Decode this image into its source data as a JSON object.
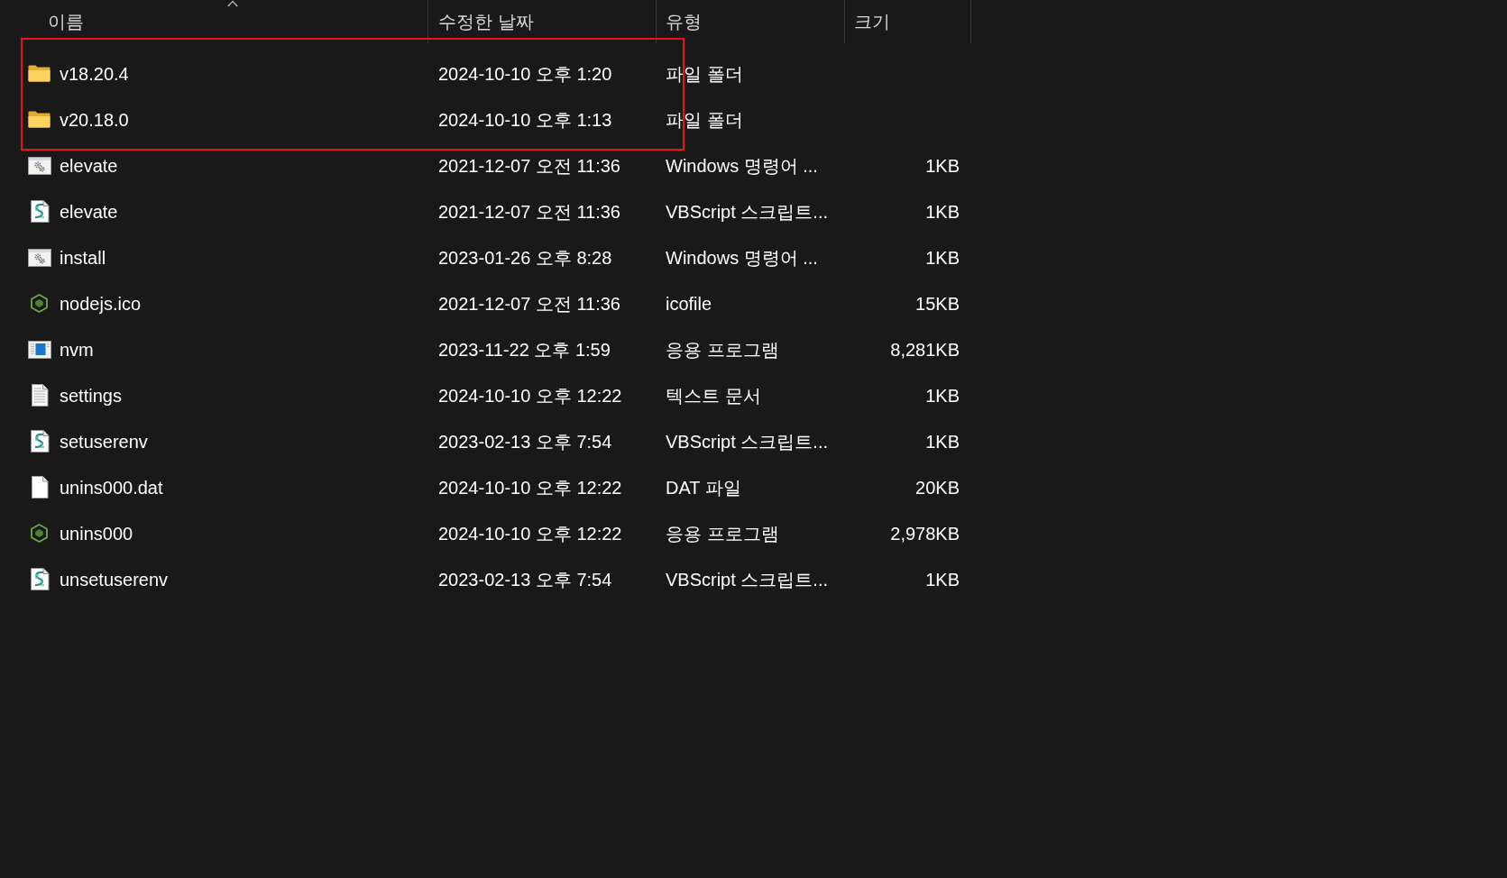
{
  "table": {
    "columns": [
      {
        "label": "이름",
        "sorted": true
      },
      {
        "label": "수정한 날짜",
        "sorted": false
      },
      {
        "label": "유형",
        "sorted": false
      },
      {
        "label": "크기",
        "sorted": false
      }
    ],
    "rows": [
      {
        "kind": "folder",
        "name": "v18.20.4",
        "modified": "2024-10-10 오후 1:20",
        "type": "파일 폴더",
        "marked": true
      },
      {
        "kind": "folder",
        "name": "v20.18.0",
        "modified": "2024-10-10 오후 1:13",
        "type": "파일 폴더",
        "marked": true
      },
      {
        "kind": "batch",
        "name": "elevate",
        "modified": "2021-12-07 오전 11:36",
        "type": "Windows 명령어 ...",
        "size": "1KB",
        "marked": false
      },
      {
        "kind": "script",
        "name": "elevate",
        "modified": "2021-12-07 오전 11:36",
        "type": "VBScript 스크립트...",
        "size": "1KB",
        "marked": false
      },
      {
        "kind": "batch",
        "name": "install",
        "modified": "2023-01-26 오후 8:28",
        "type": "Windows 명령어 ...",
        "size": "1KB",
        "marked": false
      },
      {
        "kind": "node",
        "name": "nodejs.ico",
        "modified": "2021-12-07 오전 11:36",
        "type": "icofile",
        "size": "15KB",
        "marked": false
      },
      {
        "kind": "program",
        "name": "nvm",
        "modified": "2023-11-22 오후 1:59",
        "type": "응용 프로그램",
        "size": "8,281KB",
        "marked": false
      },
      {
        "kind": "text",
        "name": "settings",
        "modified": "2024-10-10 오후 12:22",
        "type": "텍스트 문서",
        "size": "1KB",
        "marked": false
      },
      {
        "kind": "script",
        "name": "setuserenv",
        "modified": "2023-02-13 오후 7:54",
        "type": "VBScript 스크립트...",
        "size": "1KB",
        "marked": false
      },
      {
        "kind": "blank",
        "name": "unins000.dat",
        "modified": "2024-10-10 오후 12:22",
        "type": "DAT 파일",
        "size": "20KB",
        "marked": false
      },
      {
        "kind": "node",
        "name": "unins000",
        "modified": "2024-10-10 오후 12:22",
        "type": "응용 프로그램",
        "size": "2,978KB",
        "marked": false
      },
      {
        "kind": "script",
        "name": "unsetuserenv",
        "modified": "2023-02-13 오후 7:54",
        "type": "VBScript 스크립트...",
        "size": "1KB",
        "marked": false
      }
    ]
  }
}
